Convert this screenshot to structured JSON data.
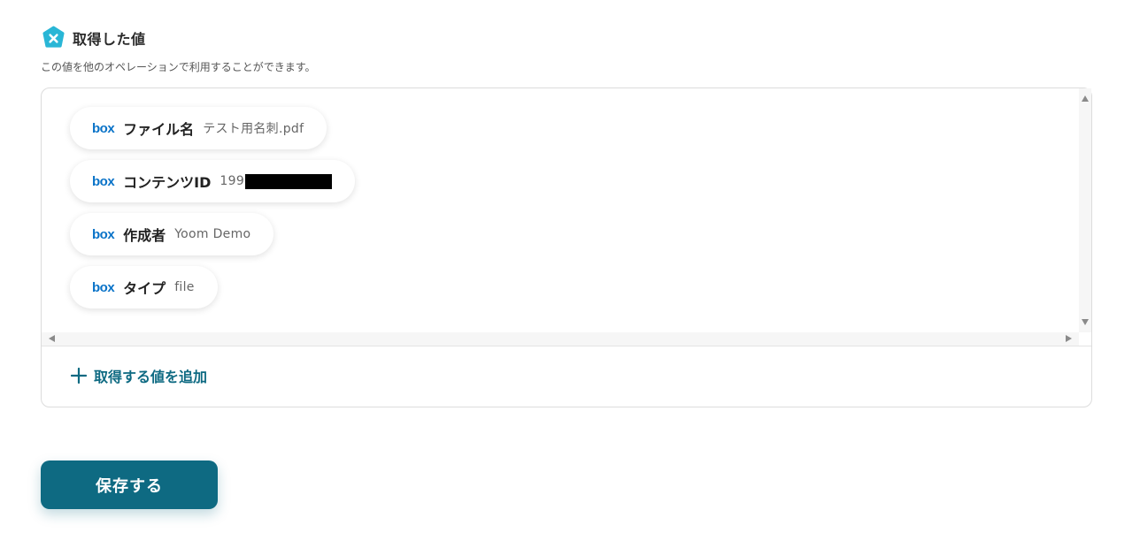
{
  "section": {
    "title": "取得した値",
    "description": "この値を他のオペレーションで利用することができます。"
  },
  "fields": [
    {
      "service": "box",
      "label": "ファイル名",
      "value": "テスト用名刺.pdf"
    },
    {
      "service": "box",
      "label": "コンテンツID",
      "value": "199"
    },
    {
      "service": "box",
      "label": "作成者",
      "value": "Yoom Demo"
    },
    {
      "service": "box",
      "label": "タイプ",
      "value": "file"
    }
  ],
  "add_value_label": "取得する値を追加",
  "save_button_label": "保存する",
  "colors": {
    "accent": "#0e6a82",
    "box_brand": "#0a73c8",
    "yoom_icon": "#29b6d6"
  },
  "icons": [
    "yoom-icon",
    "box-logo-icon",
    "plus-icon"
  ]
}
